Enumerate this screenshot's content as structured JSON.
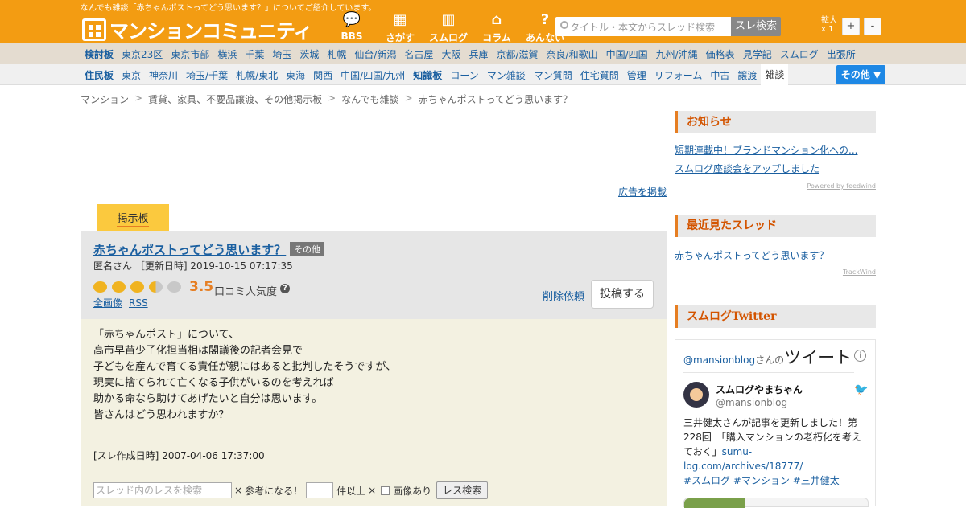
{
  "header": {
    "tagline": "なんでも雑談「赤ちゃんポストってどう思います？」についてご紹介しています。",
    "logo_text": "マンションコミュニティ",
    "nav_icons": [
      {
        "label": "BBS",
        "icon": "speech-bubble-icon",
        "glyph": "💬"
      },
      {
        "label": "さがす",
        "icon": "building-search-icon",
        "glyph": "▦"
      },
      {
        "label": "スムログ",
        "icon": "buildings-icon",
        "glyph": "▥"
      },
      {
        "label": "コラム",
        "icon": "house-icon",
        "glyph": "⌂"
      },
      {
        "label": "あんない",
        "icon": "question-icon",
        "glyph": "?"
      }
    ],
    "search_placeholder": "タイトル・本文からスレッド検索",
    "search_button": "スレ検索",
    "zoom_label_1": "拡大",
    "zoom_label_2": "x 1",
    "zoom_in": "+",
    "zoom_out": "-",
    "colors": {
      "brand": "#f39c12",
      "accent": "#e67e22",
      "link": "#1a5fa0"
    }
  },
  "nav_row_1": {
    "head": "検討板",
    "items": [
      "東京23区",
      "東京市部",
      "横浜",
      "千葉",
      "埼玉",
      "茨城",
      "札幌",
      "仙台/新潟",
      "名古屋",
      "大阪",
      "兵庫",
      "京都/滋賀",
      "奈良/和歌山",
      "中国/四国",
      "九州/沖縄",
      "価格表",
      "見学記",
      "スムログ",
      "出張所"
    ]
  },
  "nav_row_2": {
    "head": "住民板",
    "items": [
      "東京",
      "神奈川",
      "埼玉/千葉",
      "札幌/東北",
      "東海",
      "関西",
      "中国/四国/九州"
    ],
    "bold_item": "知識板",
    "items_after": [
      "ローン",
      "マン雑談",
      "マン質問",
      "住宅質問",
      "管理",
      "リフォーム",
      "中古",
      "譲渡"
    ],
    "active_item": "雑談",
    "other_button": "その他 ▼"
  },
  "breadcrumb": [
    "マンション",
    "賃貸、家具、不要品譲渡、その他掲示板",
    "なんでも雑談",
    "赤ちゃんポストってどう思います？"
  ],
  "ad_link": "広告を掲載",
  "board_tab": "掲示板",
  "thread": {
    "title": "赤ちゃんポストってどう思います？",
    "category": "その他",
    "meta": "匿名さん ［更新日時] 2019-10-15 07:17:35",
    "rating": 3.5,
    "rating_text": "3.5",
    "popularity_label": "口コミ人気度",
    "links": [
      "全画像",
      "RSS"
    ],
    "delete_request": "削除依頼",
    "post_button": "投稿する",
    "body": [
      "「赤ちゃんポスト」について、",
      "高市早苗少子化担当相は閣議後の記者会見で",
      "子どもを産んで育てる責任が親にはあると批判したそうですが、",
      "現実に捨てられて亡くなる子供がいるのを考えれば",
      "助かる命なら助けてあげたいと自分は思います。",
      "皆さんはどう思われますか？"
    ],
    "created": "[スレ作成日時] 2007-04-06 17:37:00",
    "res_search": {
      "placeholder": "スレッド内のレスを検索",
      "x1": "×",
      "useful_label": "参考になる！",
      "count_suffix": "件以上",
      "x2": "×",
      "image_label": "画像あり",
      "button": "レス検索"
    }
  },
  "sidebar": {
    "news_title": "お知らせ",
    "news_items": [
      "短期連載中！ブランドマンション化への...",
      "スムログ座談会をアップしました"
    ],
    "news_powered": "Powered by feedwind",
    "recent_title": "最近見たスレッド",
    "recent_items": [
      "赤ちゃんポストってどう思います？"
    ],
    "recent_powered": "TrackWind",
    "twitter_title": "スムログTwitter",
    "twitter": {
      "account_prefix": "@mansionblog",
      "account_suffix": "さんの",
      "tweet_word": "ツイート",
      "name": "スムログやまちゃん",
      "handle": "@mansionblog",
      "text_plain": "三井健太さんが記事を更新しました！第228回　「購入マンションの老朽化を考えておく」",
      "text_link": "sumu-log.com/archives/18777/",
      "tags": "#スムログ #マンション #三井健太"
    }
  }
}
